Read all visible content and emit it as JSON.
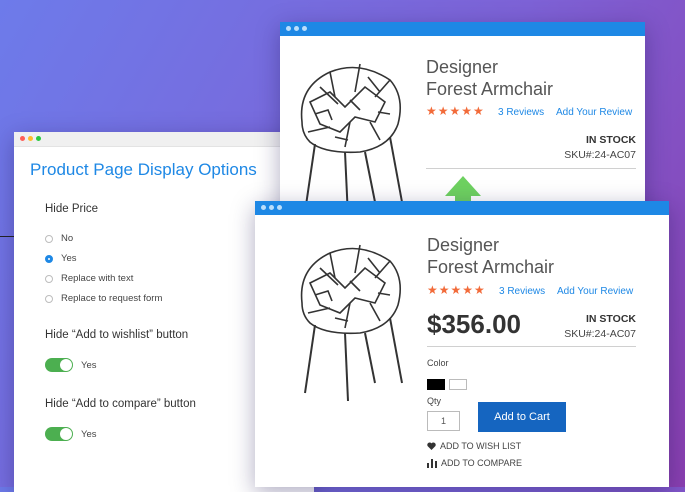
{
  "colors": {
    "accent": "#1e88e5",
    "toggle_on": "#4caf50",
    "stars": "#f26b3a",
    "cart_button": "#1565c0",
    "arrow": "#6ed160",
    "dot_red": "#ff5f57",
    "dot_yellow": "#febc2e",
    "dot_green": "#28c840"
  },
  "options_panel": {
    "title": "Product Page Display Options",
    "hide_price": {
      "heading": "Hide Price",
      "options": [
        {
          "label": "No",
          "selected": false
        },
        {
          "label": "Yes",
          "selected": true
        },
        {
          "label": "Replace with text",
          "selected": false
        },
        {
          "label": "Replace to request form",
          "selected": false
        }
      ]
    },
    "hide_wishlist": {
      "heading": "Hide “Add to wishlist” button",
      "toggle_label": "Yes",
      "on": true
    },
    "hide_compare": {
      "heading": "Hide “Add to compare” button",
      "toggle_label": "Yes",
      "on": true
    }
  },
  "product_before": {
    "name_line1": "Designer",
    "name_line2": "Forest Armchair",
    "stars": "★★★★★",
    "reviews_link": "3 Reviews",
    "add_review_link": "Add Your Review",
    "stock": "IN STOCK",
    "sku": "SKU#:24-AC07"
  },
  "product_after": {
    "name_line1": "Designer",
    "name_line2": "Forest Armchair",
    "stars": "★★★★★",
    "reviews_link": "3 Reviews",
    "add_review_link": "Add Your Review",
    "price": "$356.00",
    "stock": "IN STOCK",
    "sku": "SKU#:24-AC07",
    "color_label": "Color",
    "swatches": [
      "#000000",
      "#ffffff"
    ],
    "qty_label": "Qty",
    "qty_value": "1",
    "add_to_cart": "Add to Cart",
    "wishlist": "ADD TO WISH LIST",
    "compare": "ADD TO COMPARE"
  }
}
